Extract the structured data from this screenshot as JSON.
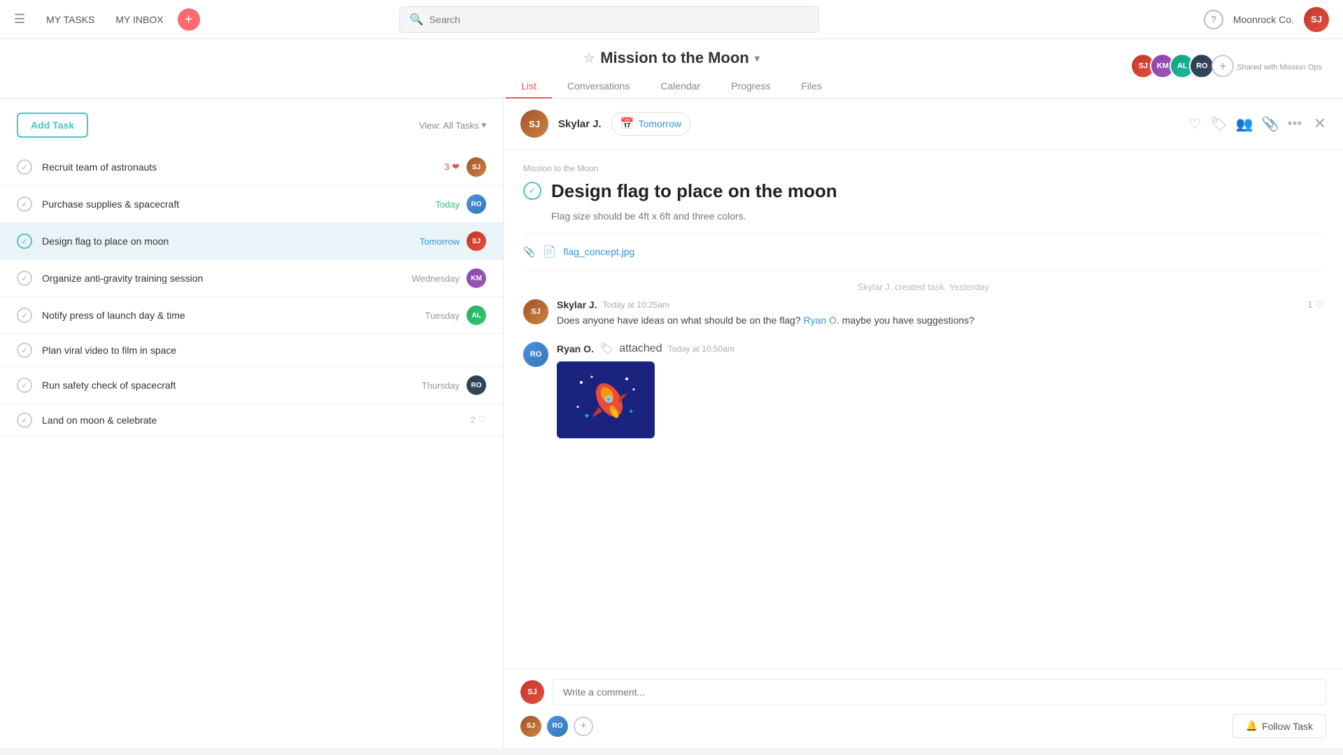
{
  "nav": {
    "my_tasks": "MY TASKS",
    "my_inbox": "MY INBOX",
    "search_placeholder": "Search",
    "help_icon": "?",
    "org_name": "Moonrock Co."
  },
  "project": {
    "title": "Mission to the Moon",
    "tabs": [
      "List",
      "Conversations",
      "Calendar",
      "Progress",
      "Files"
    ],
    "active_tab": "List",
    "shared_label": "Shared with Mission Ops"
  },
  "task_list": {
    "add_task_label": "Add Task",
    "view_label": "View: All Tasks",
    "tasks": [
      {
        "id": 1,
        "name": "Recruit team of astronauts",
        "date": "",
        "date_type": "",
        "likes": 3,
        "like_type": "heart"
      },
      {
        "id": 2,
        "name": "Purchase supplies & spacecraft",
        "date": "Today",
        "date_type": "today",
        "likes": 0
      },
      {
        "id": 3,
        "name": "Design flag to place on moon",
        "date": "Tomorrow",
        "date_type": "tomorrow",
        "likes": 0,
        "selected": true
      },
      {
        "id": 4,
        "name": "Organize anti-gravity training session",
        "date": "Wednesday",
        "date_type": "",
        "likes": 0
      },
      {
        "id": 5,
        "name": "Notify press of launch day & time",
        "date": "Tuesday",
        "date_type": "",
        "likes": 0
      },
      {
        "id": 6,
        "name": "Plan viral video to film in space",
        "date": "",
        "date_type": "",
        "likes": 0
      },
      {
        "id": 7,
        "name": "Run safety check of spacecraft",
        "date": "Thursday",
        "date_type": "",
        "likes": 0
      },
      {
        "id": 8,
        "name": "Land on moon & celebrate",
        "date": "",
        "date_type": "",
        "likes": 2,
        "like_type": "heart-outline"
      }
    ]
  },
  "task_detail": {
    "assignee": "Skylar J.",
    "due_date": "Tomorrow",
    "project_label": "Mission to the Moon",
    "title": "Design flag to place on the moon",
    "description": "Flag size should be 4ft x 6ft and three colors.",
    "attachment_name": "flag_concept.jpg",
    "activity_created": "Skylar J. created task.  Yesterday",
    "comments": [
      {
        "author": "Skylar J.",
        "time": "Today at 10:25am",
        "text": "Does anyone have ideas on what should be on the flag?",
        "mention": "Ryan O.",
        "text_after": " maybe you have suggestions?",
        "likes": 1
      },
      {
        "author": "Ryan O.",
        "time": "Today at 10:50am",
        "attached": true,
        "attached_word": "attached"
      }
    ],
    "comment_placeholder": "Write a comment...",
    "follow_task_label": "Follow Task"
  }
}
